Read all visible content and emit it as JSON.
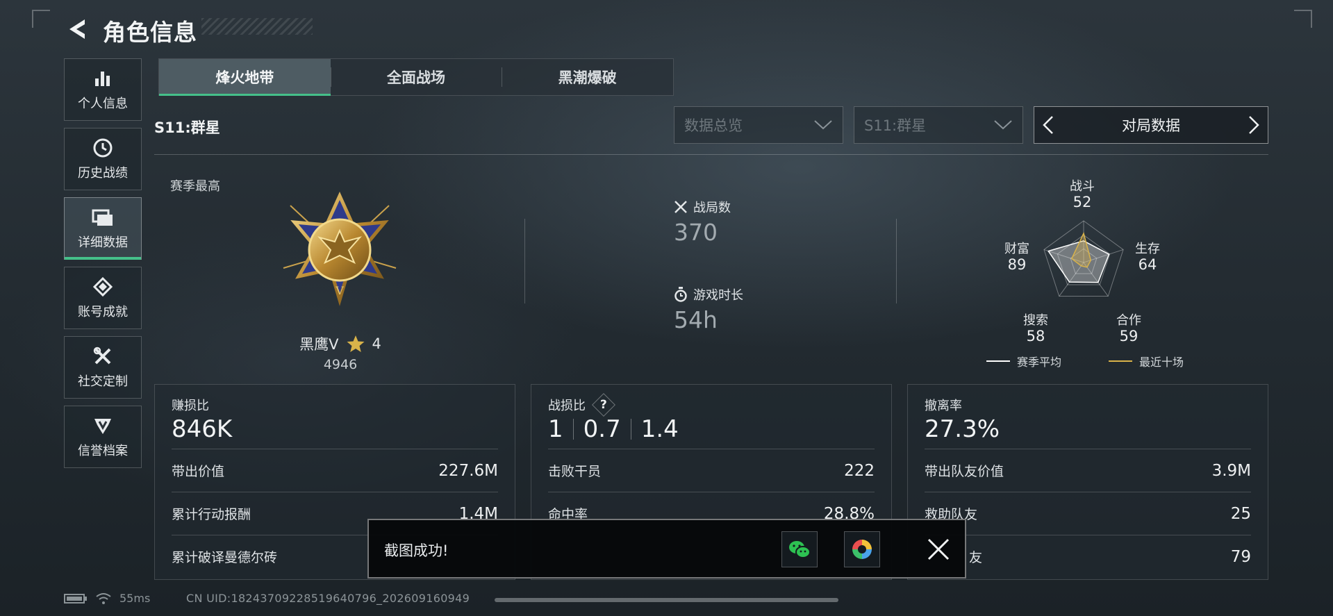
{
  "header": {
    "title": "角色信息"
  },
  "sidebar": {
    "items": [
      {
        "label": "个人信息",
        "icon": "bar-chart-icon"
      },
      {
        "label": "历史战绩",
        "icon": "clock-icon"
      },
      {
        "label": "详细数据",
        "icon": "folder-icon",
        "active": true
      },
      {
        "label": "账号成就",
        "icon": "achievement-icon"
      },
      {
        "label": "社交定制",
        "icon": "tools-icon"
      },
      {
        "label": "信誉档案",
        "icon": "shield-badge-icon"
      }
    ]
  },
  "tabs": [
    {
      "label": "烽火地带",
      "active": true
    },
    {
      "label": "全面战场"
    },
    {
      "label": "黑潮爆破"
    }
  ],
  "season": {
    "label": "S11:群星",
    "filter_view": "数据总览",
    "filter_season": "S11:群星",
    "switcher_label": "对局数据"
  },
  "peak": {
    "caption": "赛季最高",
    "rank_name": "黑鹰V",
    "stars": "4",
    "score": "4946"
  },
  "overview": {
    "matches_label": "战局数",
    "matches_value": "370",
    "playtime_label": "游戏时长",
    "playtime_value": "54h"
  },
  "radar": {
    "axes": [
      {
        "label": "战斗",
        "value": 52
      },
      {
        "label": "生存",
        "value": 64
      },
      {
        "label": "合作",
        "value": 59
      },
      {
        "label": "搜索",
        "value": 58
      },
      {
        "label": "财富",
        "value": 89
      }
    ],
    "legend_season": "赛季平均",
    "legend_recent": "最近十场",
    "colors": {
      "season": "#ffffff",
      "recent": "#d9b34a"
    }
  },
  "cards": {
    "profit": {
      "label": "赚损比",
      "value": "846K",
      "rows": [
        {
          "label": "带出价值",
          "value": "227.6M"
        },
        {
          "label": "累计行动报酬",
          "value": "1.4M"
        },
        {
          "label": "累计破译曼德尔砖",
          "value": ""
        }
      ]
    },
    "kd": {
      "label": "战损比",
      "help": "?",
      "values": [
        "1",
        "0.7",
        "1.4"
      ],
      "rows": [
        {
          "label": "击败干员",
          "value": "222"
        },
        {
          "label": "命中率",
          "value": "28.8%"
        }
      ]
    },
    "extract": {
      "label": "撤离率",
      "value": "27.3%",
      "rows": [
        {
          "label": "带出队友价值",
          "value": "3.9M"
        },
        {
          "label": "救助队友",
          "value": "25"
        },
        {
          "label": "友",
          "value": "79"
        }
      ]
    }
  },
  "toast": {
    "message": "截图成功!"
  },
  "status": {
    "ping": "55ms",
    "uid": "CN UID:18243709228519640796_202609160949"
  },
  "colors": {
    "accent": "#45c08a",
    "gold": "#d9b34a"
  }
}
